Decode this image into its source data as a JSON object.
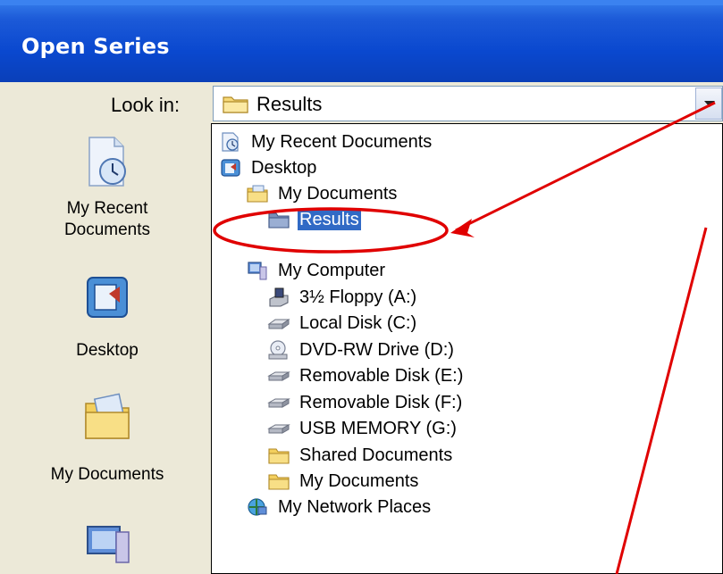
{
  "window": {
    "title": "Open Series"
  },
  "lookin": {
    "label": "Look in:",
    "value": "Results"
  },
  "places": [
    {
      "label_line1": "My Recent",
      "label_line2": "Documents"
    },
    {
      "label_line1": "Desktop",
      "label_line2": ""
    },
    {
      "label_line1": "My Documents",
      "label_line2": ""
    }
  ],
  "dropdown": {
    "items": [
      {
        "label": "My Recent Documents",
        "icon": "recent-documents-icon"
      },
      {
        "label": "Desktop",
        "icon": "desktop-icon"
      },
      {
        "label": "My Documents",
        "icon": "my-documents-folder-icon"
      },
      {
        "label": "Results",
        "icon": "folder-icon",
        "selected": true
      },
      {
        "label": "My Computer",
        "icon": "computer-icon"
      },
      {
        "label": "3½ Floppy (A:)",
        "icon": "floppy-drive-icon"
      },
      {
        "label": "Local Disk (C:)",
        "icon": "hard-disk-icon"
      },
      {
        "label": "DVD-RW Drive (D:)",
        "icon": "dvd-drive-icon"
      },
      {
        "label": "Removable Disk (E:)",
        "icon": "removable-disk-icon"
      },
      {
        "label": "Removable Disk (F:)",
        "icon": "removable-disk-icon"
      },
      {
        "label": "USB MEMORY (G:)",
        "icon": "removable-disk-icon"
      },
      {
        "label": "Shared Documents",
        "icon": "folder-icon"
      },
      {
        "label": "My Documents",
        "icon": "folder-icon"
      },
      {
        "label": "My Network Places",
        "icon": "network-places-icon"
      }
    ]
  },
  "colors": {
    "titlebar": "#0a48cf",
    "selection": "#316ac5",
    "annotation": "#e00000",
    "dialog_bg": "#ECE9D8"
  }
}
